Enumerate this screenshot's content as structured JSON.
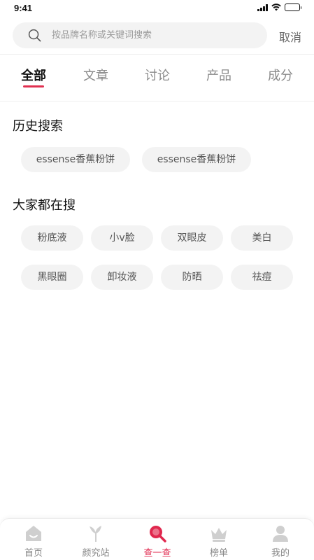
{
  "status_bar": {
    "time": "9:41"
  },
  "search": {
    "placeholder": "按品牌名称或关键词搜索",
    "value": "",
    "cancel_label": "取消"
  },
  "tabs": [
    {
      "label": "全部",
      "active": true
    },
    {
      "label": "文章",
      "active": false
    },
    {
      "label": "讨论",
      "active": false
    },
    {
      "label": "产品",
      "active": false
    },
    {
      "label": "成分",
      "active": false
    }
  ],
  "history": {
    "title": "历史搜索",
    "items": [
      "essense香蕉粉饼",
      "essense香蕉粉饼"
    ]
  },
  "popular": {
    "title": "大家都在搜",
    "items": [
      "粉底液",
      "小v脸",
      "双眼皮",
      "美白",
      "黑眼圈",
      "卸妆液",
      "防晒",
      "祛痘"
    ]
  },
  "bottom_nav": [
    {
      "label": "首页",
      "icon": "home-icon"
    },
    {
      "label": "颜究站",
      "icon": "leaf-icon"
    },
    {
      "label": "查一查",
      "icon": "search-icon",
      "active": true
    },
    {
      "label": "榜单",
      "icon": "crown-icon"
    },
    {
      "label": "我的",
      "icon": "user-icon"
    }
  ],
  "colors": {
    "accent": "#e0284e",
    "chip_bg": "#f3f3f3",
    "icon_gray": "#cfcfcf"
  }
}
